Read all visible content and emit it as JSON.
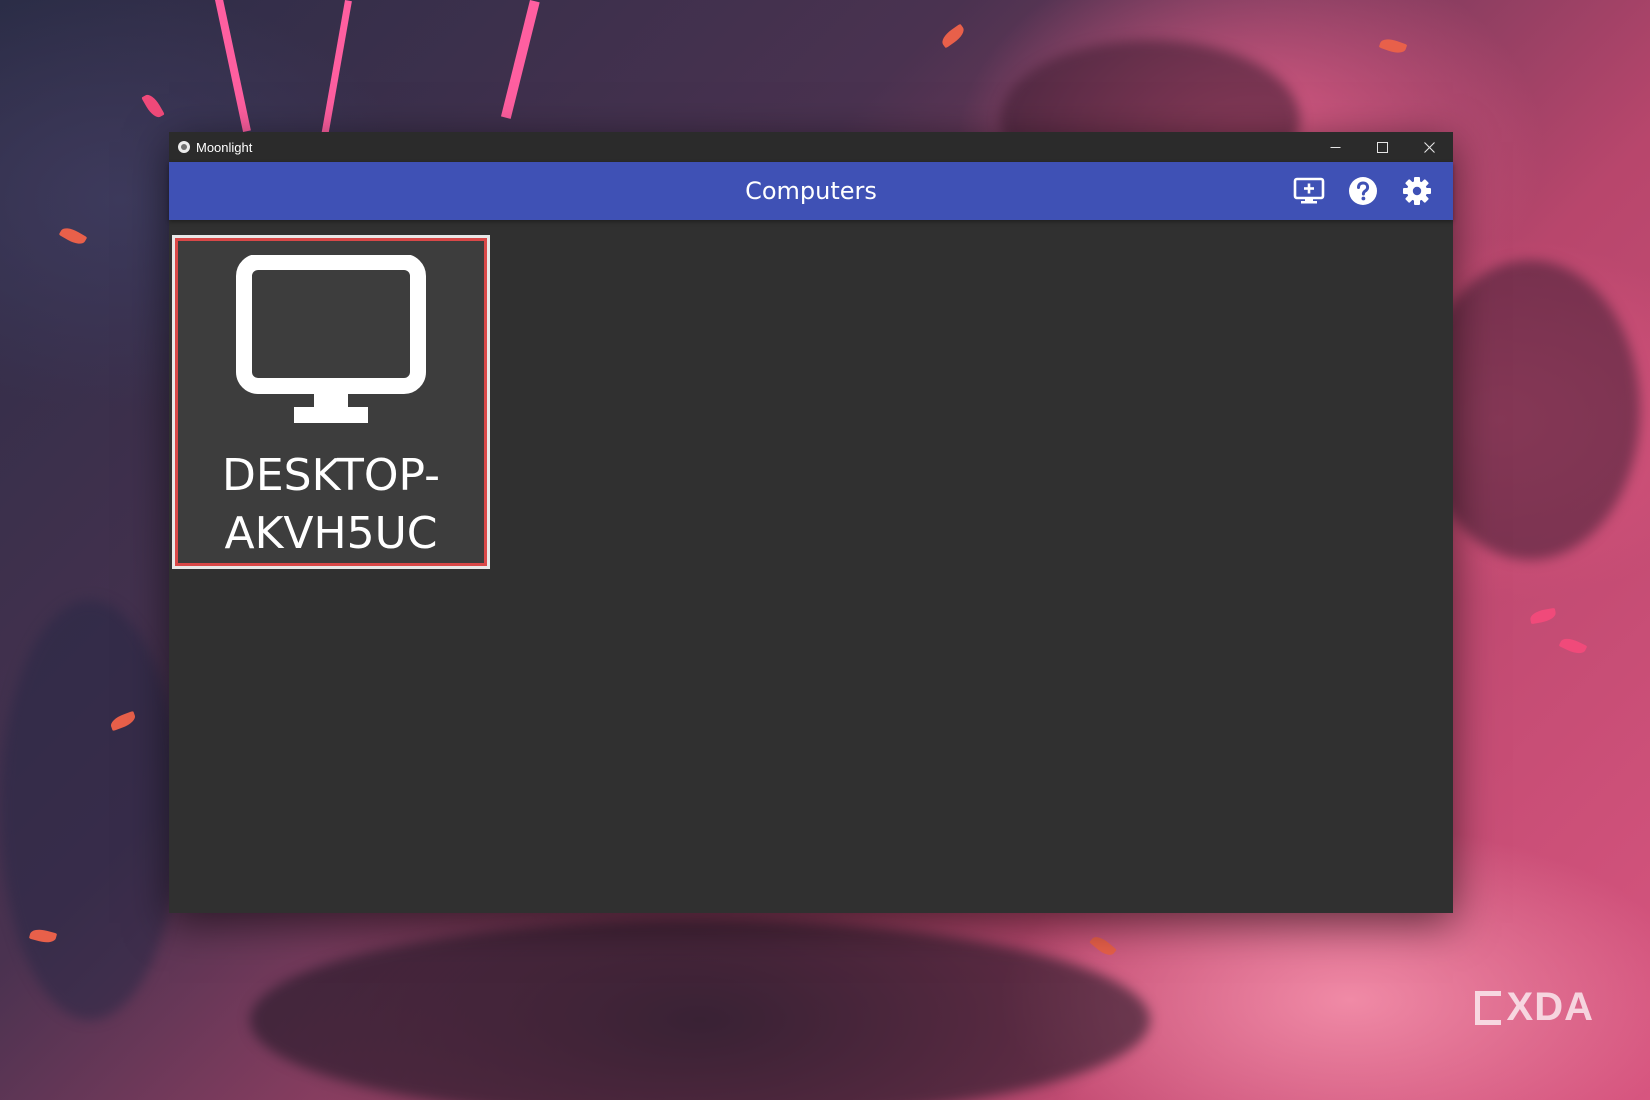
{
  "window": {
    "title": "Moonlight"
  },
  "toolbar": {
    "title": "Computers",
    "actions": [
      {
        "name": "add-pc",
        "icon": "monitor-plus-icon"
      },
      {
        "name": "help",
        "icon": "help-circle-icon"
      },
      {
        "name": "settings",
        "icon": "gear-icon"
      }
    ],
    "color": "#3f51b5"
  },
  "computers": [
    {
      "name_line1": "DESKTOP-",
      "name_line2": "AKVH5UC",
      "icon": "monitor-icon",
      "selected": true
    }
  ],
  "watermark": {
    "text": "XDA"
  },
  "colors": {
    "window_bg": "#303030",
    "tile_bg": "#3d3d3d",
    "selection_border": "#d94848"
  }
}
